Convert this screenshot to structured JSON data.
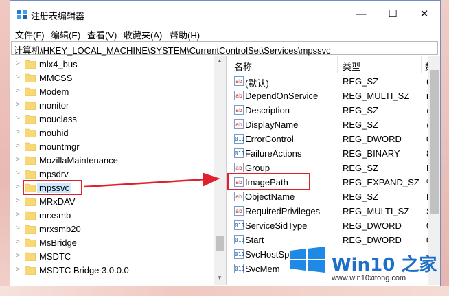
{
  "window": {
    "title": "注册表编辑器",
    "controls": {
      "minimize": "—",
      "maximize": "☐",
      "close": "✕"
    }
  },
  "menu": [
    "文件(F)",
    "编辑(E)",
    "查看(V)",
    "收藏夹(A)",
    "帮助(H)"
  ],
  "address": "计算机\\HKEY_LOCAL_MACHINE\\SYSTEM\\CurrentControlSet\\Services\\mpssvc",
  "tree": {
    "items": [
      {
        "label": "mlx4_bus"
      },
      {
        "label": "MMCSS"
      },
      {
        "label": "Modem"
      },
      {
        "label": "monitor"
      },
      {
        "label": "mouclass"
      },
      {
        "label": "mouhid"
      },
      {
        "label": "mountmgr"
      },
      {
        "label": "MozillaMaintenance"
      },
      {
        "label": "mpsdrv"
      },
      {
        "label": "mpssvc",
        "selected": true
      },
      {
        "label": "MRxDAV"
      },
      {
        "label": "mrxsmb"
      },
      {
        "label": "mrxsmb20"
      },
      {
        "label": "MsBridge"
      },
      {
        "label": "MSDTC"
      },
      {
        "label": "MSDTC Bridge 3.0.0.0"
      }
    ]
  },
  "values": {
    "headers": {
      "name": "名称",
      "type": "类型",
      "data": "数"
    },
    "rows": [
      {
        "name": "(默认)",
        "type": "REG_SZ",
        "data": "(",
        "icon": "string-value-icon"
      },
      {
        "name": "DependOnService",
        "type": "REG_MULTI_SZ",
        "data": "r",
        "icon": "string-value-icon"
      },
      {
        "name": "Description",
        "type": "REG_SZ",
        "data": "@",
        "icon": "string-value-icon"
      },
      {
        "name": "DisplayName",
        "type": "REG_SZ",
        "data": "@",
        "icon": "string-value-icon"
      },
      {
        "name": "ErrorControl",
        "type": "REG_DWORD",
        "data": "0",
        "icon": "binary-value-icon"
      },
      {
        "name": "FailureActions",
        "type": "REG_BINARY",
        "data": "8",
        "icon": "binary-value-icon"
      },
      {
        "name": "Group",
        "type": "REG_SZ",
        "data": "N",
        "icon": "string-value-icon"
      },
      {
        "name": "ImagePath",
        "type": "REG_EXPAND_SZ",
        "data": "%",
        "icon": "string-value-icon",
        "highlighted": true
      },
      {
        "name": "ObjectName",
        "type": "REG_SZ",
        "data": "N",
        "icon": "string-value-icon"
      },
      {
        "name": "RequiredPrivileges",
        "type": "REG_MULTI_SZ",
        "data": "S",
        "icon": "string-value-icon"
      },
      {
        "name": "ServiceSidType",
        "type": "REG_DWORD",
        "data": "0",
        "icon": "binary-value-icon"
      },
      {
        "name": "Start",
        "type": "REG_DWORD",
        "data": "0",
        "icon": "binary-value-icon"
      },
      {
        "name": "SvcHostSp",
        "type": "",
        "data": "",
        "icon": "binary-value-icon"
      },
      {
        "name": "SvcMem",
        "type": "",
        "data": "",
        "icon": "binary-value-icon"
      }
    ]
  },
  "watermark": {
    "brand": "Win10 之家",
    "url": "www.win10xitong.com"
  },
  "colors": {
    "highlight": "#e0202a",
    "selection": "#cce8ff",
    "brand": "#1e6fc7"
  }
}
